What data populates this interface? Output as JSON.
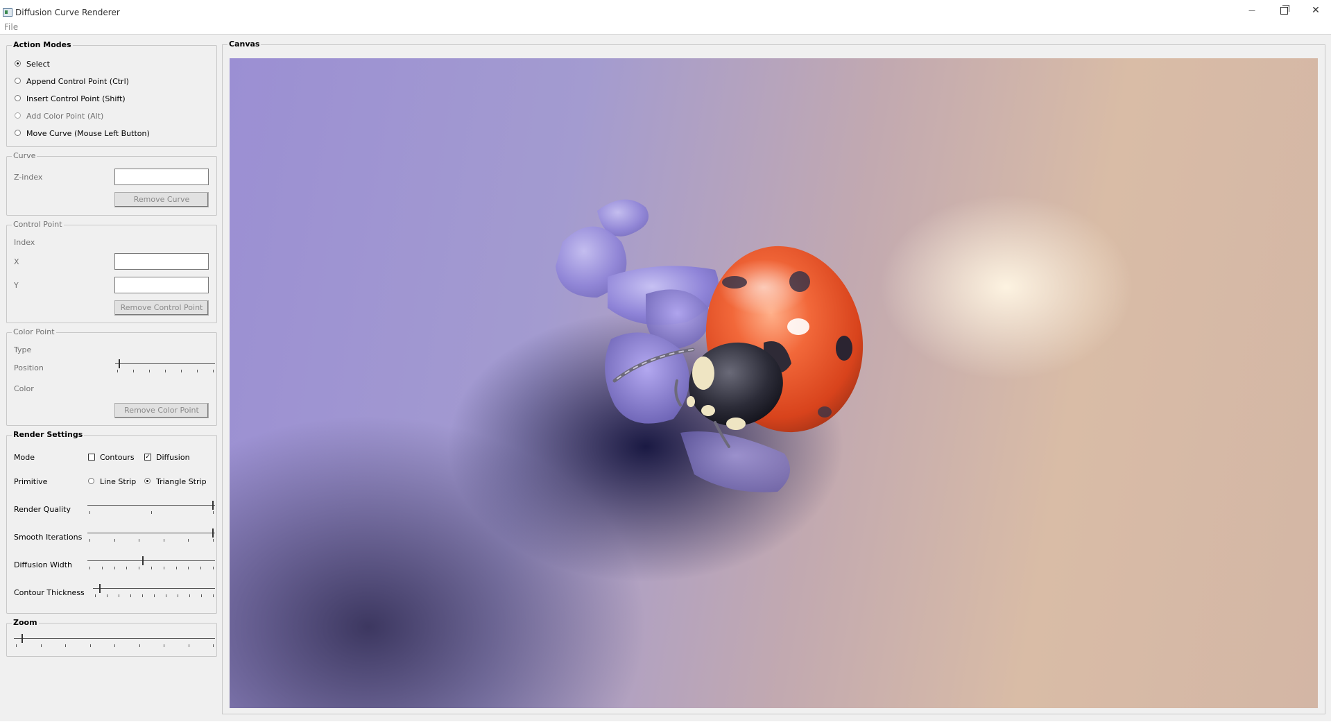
{
  "window": {
    "title": "Diffusion Curve Renderer",
    "controls": {
      "minimize": "—",
      "close": "✕"
    }
  },
  "menu": {
    "file": "File"
  },
  "action_modes": {
    "title": "Action Modes",
    "options": [
      {
        "label": "Select",
        "selected": true,
        "enabled": true
      },
      {
        "label": "Append Control Point (Ctrl)",
        "selected": false,
        "enabled": true
      },
      {
        "label": "Insert Control Point (Shift)",
        "selected": false,
        "enabled": true
      },
      {
        "label": "Add Color Point (Alt)",
        "selected": false,
        "enabled": false
      },
      {
        "label": "Move Curve (Mouse Left Button)",
        "selected": false,
        "enabled": true
      }
    ]
  },
  "curve": {
    "title": "Curve",
    "z_index_label": "Z-index",
    "z_index_value": "",
    "remove_button": "Remove Curve"
  },
  "control_point": {
    "title": "Control Point",
    "index_label": "Index",
    "x_label": "X",
    "x_value": "",
    "y_label": "Y",
    "y_value": "",
    "remove_button": "Remove Control Point"
  },
  "color_point": {
    "title": "Color Point",
    "type_label": "Type",
    "position_label": "Position",
    "position_value": 0.02,
    "color_label": "Color",
    "remove_button": "Remove Color Point"
  },
  "render_settings": {
    "title": "Render Settings",
    "mode_label": "Mode",
    "contours_label": "Contours",
    "contours_checked": false,
    "diffusion_label": "Diffusion",
    "diffusion_checked": true,
    "primitive_label": "Primitive",
    "line_strip_label": "Line Strip",
    "line_strip_selected": false,
    "triangle_strip_label": "Triangle Strip",
    "triangle_strip_selected": true,
    "render_quality_label": "Render Quality",
    "render_quality_value": 1.0,
    "smooth_iterations_label": "Smooth Iterations",
    "smooth_iterations_value": 1.0,
    "diffusion_width_label": "Diffusion Width",
    "diffusion_width_value": 0.43,
    "contour_thickness_label": "Contour Thickness",
    "contour_thickness_value": 0.04
  },
  "zoom": {
    "title": "Zoom",
    "value": 0.03
  },
  "canvas": {
    "title": "Canvas"
  }
}
